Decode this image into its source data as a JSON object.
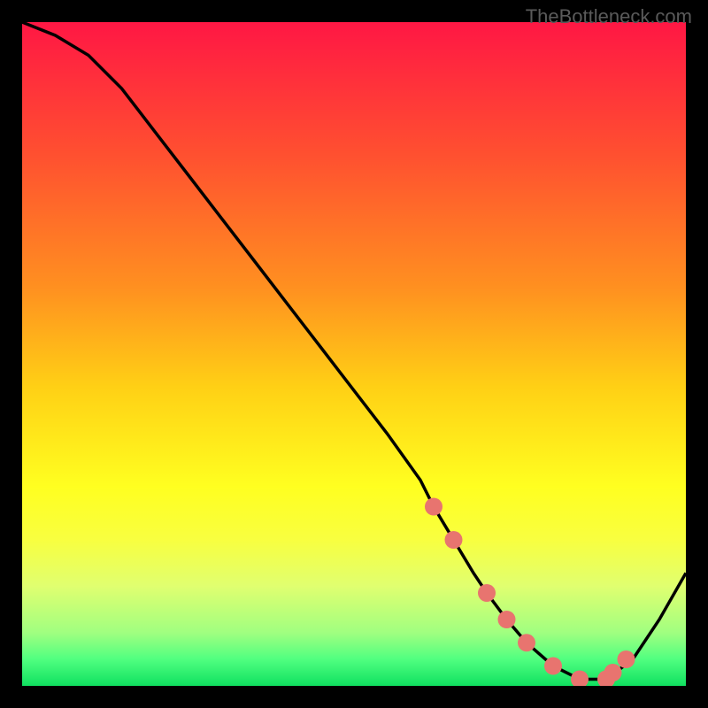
{
  "watermark": "TheBottleneck.com",
  "chart_data": {
    "type": "line",
    "title": "",
    "xlabel": "",
    "ylabel": "",
    "xlim": [
      0,
      100
    ],
    "ylim": [
      0,
      100
    ],
    "curve": {
      "x": [
        0,
        5,
        10,
        15,
        20,
        25,
        30,
        35,
        40,
        45,
        50,
        55,
        60,
        62,
        65,
        68,
        70,
        73,
        76,
        80,
        84,
        88,
        92,
        96,
        100
      ],
      "y": [
        100,
        98,
        95,
        90,
        83.5,
        77,
        70.5,
        64,
        57.5,
        51,
        44.5,
        38,
        31,
        27,
        22,
        17,
        14,
        10,
        6.5,
        3,
        1,
        1,
        4,
        10,
        17
      ]
    },
    "dots": {
      "x": [
        62,
        65,
        70,
        73,
        76,
        80,
        84,
        88,
        89,
        91
      ],
      "y": [
        27,
        22,
        14,
        10,
        6.5,
        3,
        1,
        1,
        2,
        4
      ]
    },
    "gradient_stops": [
      {
        "offset": 0,
        "color": "#ff1744"
      },
      {
        "offset": 20,
        "color": "#ff5030"
      },
      {
        "offset": 40,
        "color": "#ff9020"
      },
      {
        "offset": 55,
        "color": "#ffd015"
      },
      {
        "offset": 70,
        "color": "#ffff20"
      },
      {
        "offset": 78,
        "color": "#f8ff40"
      },
      {
        "offset": 85,
        "color": "#e0ff70"
      },
      {
        "offset": 92,
        "color": "#a0ff80"
      },
      {
        "offset": 96,
        "color": "#50ff80"
      },
      {
        "offset": 100,
        "color": "#10e060"
      }
    ],
    "dot_color": "#e8746f",
    "curve_color": "#000000"
  }
}
